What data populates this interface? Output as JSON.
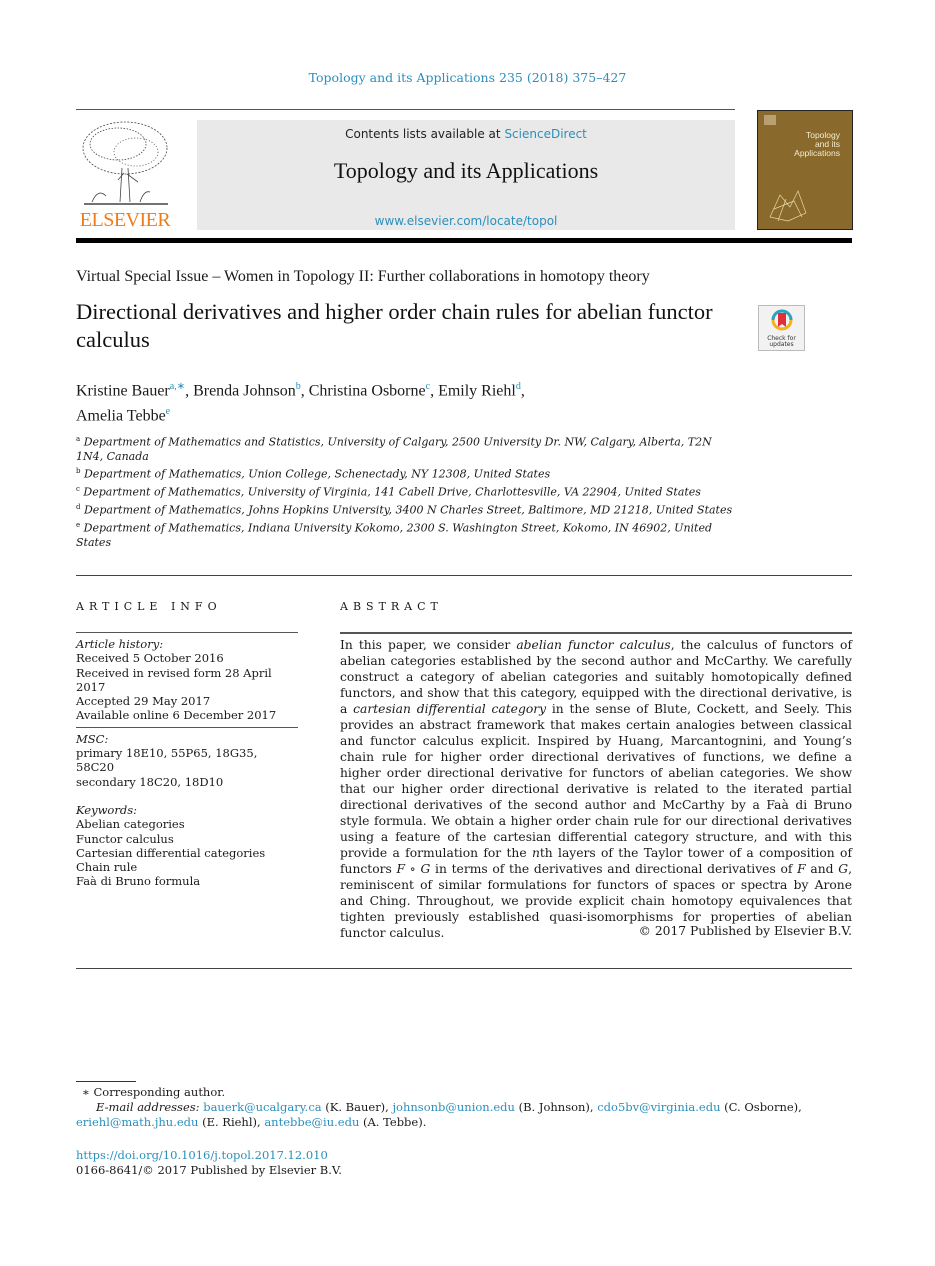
{
  "journal_reference": "Topology and its Applications 235 (2018) 375–427",
  "header": {
    "publisher_logo_text": "ELSEVIER",
    "contents_prefix": "Contents lists available at ",
    "contents_link": "ScienceDirect",
    "journal_title": "Topology and its Applications",
    "journal_url": "www.elsevier.com/locate/topol",
    "cover_title_lines": [
      "Topology",
      "and its",
      "Applications"
    ]
  },
  "special_issue": "Virtual Special Issue – Women in Topology II: Further collaborations in homotopy theory",
  "article_title": "Directional derivatives and higher order chain rules for abelian functor calculus",
  "check_updates_label": [
    "Check for",
    "updates"
  ],
  "authors": [
    {
      "name": "Kristine Bauer",
      "sup": "a,∗",
      "sep": ", "
    },
    {
      "name": "Brenda Johnson",
      "sup": "b",
      "sep": ", "
    },
    {
      "name": "Christina Osborne",
      "sup": "c",
      "sep": ", "
    },
    {
      "name": "Emily Riehl",
      "sup": "d",
      "sep": ","
    },
    {
      "name": "Amelia Tebbe",
      "sup": "e",
      "sep": ""
    }
  ],
  "affiliations": [
    {
      "label": "a",
      "text": "Department of Mathematics and Statistics, University of Calgary, 2500 University Dr. NW, Calgary, Alberta, T2N 1N4, Canada"
    },
    {
      "label": "b",
      "text": "Department of Mathematics, Union College, Schenectady, NY 12308, United States"
    },
    {
      "label": "c",
      "text": "Department of Mathematics, University of Virginia, 141 Cabell Drive, Charlottesville, VA 22904, United States"
    },
    {
      "label": "d",
      "text": "Department of Mathematics, Johns Hopkins University, 3400 N Charles Street, Baltimore, MD 21218, United States"
    },
    {
      "label": "e",
      "text": "Department of Mathematics, Indiana University Kokomo, 2300 S. Washington Street, Kokomo, IN 46902, United States"
    }
  ],
  "article_info": {
    "heading": "ARTICLE INFO",
    "history_heading": "Article history:",
    "history": [
      "Received 5 October 2016",
      "Received in revised form 28 April 2017",
      "Accepted 29 May 2017",
      "Available online 6 December 2017"
    ],
    "msc_heading": "MSC:",
    "msc": [
      "primary 18E10, 55P65, 18G35, 58C20",
      "secondary 18C20, 18D10"
    ],
    "keywords_heading": "Keywords:",
    "keywords": [
      "Abelian categories",
      "Functor calculus",
      "Cartesian differential categories",
      "Chain rule",
      "Faà di Bruno formula"
    ]
  },
  "abstract": {
    "heading": "ABSTRACT",
    "segments": [
      {
        "t": "In this paper, we consider ",
        "i": false
      },
      {
        "t": "abelian functor calculus",
        "i": true
      },
      {
        "t": ", the calculus of functors of abelian categories established by the second author and McCarthy. We carefully construct a category of abelian categories and suitably homotopically defined functors, and show that this category, equipped with the directional derivative, is a ",
        "i": false
      },
      {
        "t": "cartesian differential category",
        "i": true
      },
      {
        "t": " in the sense of Blute, Cockett, and Seely. This provides an abstract framework that makes certain analogies between classical and functor calculus explicit. Inspired by Huang, Marcantognini, and Young’s chain rule for higher order directional derivatives of functions, we define a higher order directional derivative for functors of abelian categories. We show that our higher order directional derivative is related to the iterated partial directional derivatives of the second author and McCarthy by a Faà di Bruno style formula. We obtain a higher order chain rule for our directional derivatives using a feature of the cartesian differential category structure, and with this provide a formulation for the ",
        "i": false
      },
      {
        "t": "n",
        "i": true
      },
      {
        "t": "th layers of the Taylor tower of a composition of functors ",
        "i": false
      },
      {
        "t": "F ∘ G",
        "i": true
      },
      {
        "t": " in terms of the derivatives and directional derivatives of ",
        "i": false
      },
      {
        "t": "F",
        "i": true
      },
      {
        "t": " and ",
        "i": false
      },
      {
        "t": "G",
        "i": true
      },
      {
        "t": ", reminiscent of similar formulations for functors of spaces or spectra by Arone and Ching. Throughout, we provide explicit chain homotopy equivalences that tighten previously established quasi-isomorphisms for properties of abelian functor calculus.",
        "i": false
      }
    ],
    "copyright": "© 2017 Published by Elsevier B.V."
  },
  "footnotes": {
    "corresponding": "∗  Corresponding author.",
    "email_label": "E-mail addresses:",
    "emails": [
      {
        "email": "bauerk@ucalgary.ca",
        "who": " (K. Bauer), "
      },
      {
        "email": "johnsonb@union.edu",
        "who": " (B. Johnson), "
      },
      {
        "email": "cdo5bv@virginia.edu",
        "who": " (C. Osborne), "
      },
      {
        "email": "eriehl@math.jhu.edu",
        "who": " (E. Riehl), "
      },
      {
        "email": "antebbe@iu.edu",
        "who": " (A. Tebbe)."
      }
    ],
    "doi": "https://doi.org/10.1016/j.topol.2017.12.010",
    "issn_line": "0166-8641/© 2017 Published by Elsevier B.V."
  },
  "colors": {
    "link": "#2a8fbd",
    "elsevier_orange": "#f07c1a",
    "cover_brown": "#8a6a2c",
    "header_gray": "#e9e9e9"
  }
}
